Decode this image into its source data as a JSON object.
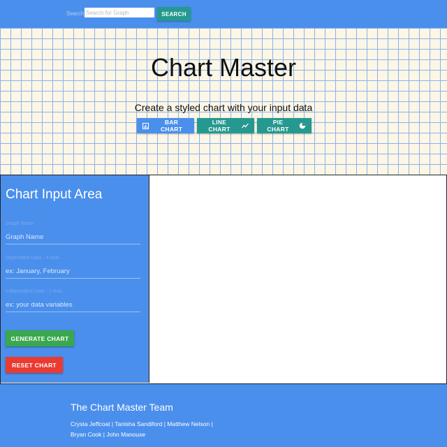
{
  "nav": {
    "search_label": "Search",
    "search_placeholder": "Search for Graph",
    "search_button": "SEARCH"
  },
  "hero": {
    "title": "Chart Master",
    "subtitle": "Create a styled chart with your input data",
    "buttons": [
      {
        "label": "BAR CHART",
        "icon": "bar-chart-icon"
      },
      {
        "label": "LINE CHART",
        "icon": "line-chart-icon"
      },
      {
        "label": "PIE CHART",
        "icon": "pie-chart-icon"
      }
    ]
  },
  "input_panel": {
    "title": "Chart Input Area",
    "fields": [
      {
        "label": "Graph Name",
        "placeholder": "Graph Name"
      },
      {
        "label": "Dependent Data - X Axis",
        "placeholder": "ex: January, February"
      },
      {
        "label": "Independent Data - Y Axis",
        "placeholder": "ex: your data variables"
      }
    ],
    "generate_button": "GENERATE CHART",
    "reset_button": "RESET CHART"
  },
  "footer": {
    "title": "The Chart Master Team",
    "team_line1": "Crysta Jeffcoat | Tanisha Sandiford | Matthew Nelson |",
    "team_line2": "Bryan Cook | John Manouse"
  },
  "colors": {
    "primary_blue": "#4a8fec",
    "teal": "#25998f",
    "green": "#3aa84f",
    "red": "#ea3b32",
    "grid_background": "#fbf6e6"
  }
}
